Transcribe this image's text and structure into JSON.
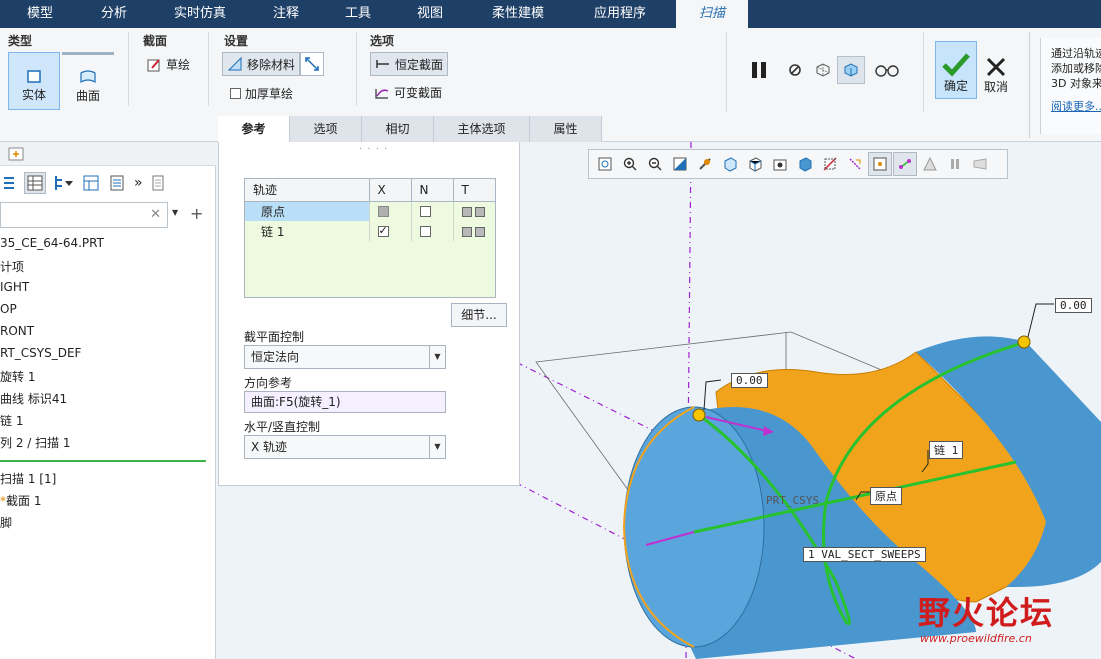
{
  "menu": {
    "tabs": [
      "模型",
      "分析",
      "实时仿真",
      "注释",
      "工具",
      "视图",
      "柔性建模",
      "应用程序",
      "扫描"
    ],
    "active": "扫描"
  },
  "ribbon": {
    "type_group": {
      "title": "类型",
      "solid": "实体",
      "surface": "曲面"
    },
    "section_group": {
      "title": "截面",
      "sketch": "草绘"
    },
    "settings_group": {
      "title": "设置",
      "remove_material": "移除材料",
      "thicken_sketch": "加厚草绘"
    },
    "options_group": {
      "title": "选项",
      "constant_section": "恒定截面",
      "variable_section": "可变截面"
    },
    "ok": "确定",
    "cancel": "取消",
    "hint_lines": [
      "通过沿轨迹",
      "添加或移除",
      "3D 对象来"
    ],
    "hint_link": "阅读更多..."
  },
  "subtabs": [
    "参考",
    "选项",
    "相切",
    "主体选项",
    "属性"
  ],
  "tree": {
    "items": [
      "35_CE_64-64.PRT",
      "计项",
      "IGHT",
      "OP",
      "RONT",
      "RT_CSYS_DEF",
      "旋转 1",
      "曲线 标识41",
      "链 1",
      "列 2 / 扫描 1",
      "扫描 1 [1]",
      "截面 1",
      "脚"
    ]
  },
  "refpanel": {
    "columns": [
      "轨迹",
      "X",
      "N",
      "T"
    ],
    "rows": [
      {
        "name": "原点",
        "x": "grey",
        "n": "unchecked",
        "selected": true
      },
      {
        "name": "链 1",
        "x": "checked",
        "n": "unchecked",
        "selected": false
      }
    ],
    "detail_button": "细节...",
    "section_control_label": "截平面控制",
    "section_control_value": "恒定法向",
    "direction_ref_label": "方向参考",
    "direction_ref_value": "曲面:F5(旋转_1)",
    "hv_control_label": "水平/竖直控制",
    "hv_control_value": "X 轨迹"
  },
  "viewport": {
    "dim_left": "0.00",
    "dim_right": "0.00",
    "tag_chain": "链 1",
    "tag_origin": "原点",
    "tag_csys": "PRT_CSYS",
    "tag_sweep": "1 VAL_SECT_SWEEPS",
    "watermark": "野火论坛",
    "watermark_url": "www.proewildfire.cn"
  },
  "colors": {
    "menubar": "#1e3f66",
    "model_blue": "#4a97cf",
    "model_orange": "#f2a31c",
    "trajectory": "#27c22e"
  }
}
